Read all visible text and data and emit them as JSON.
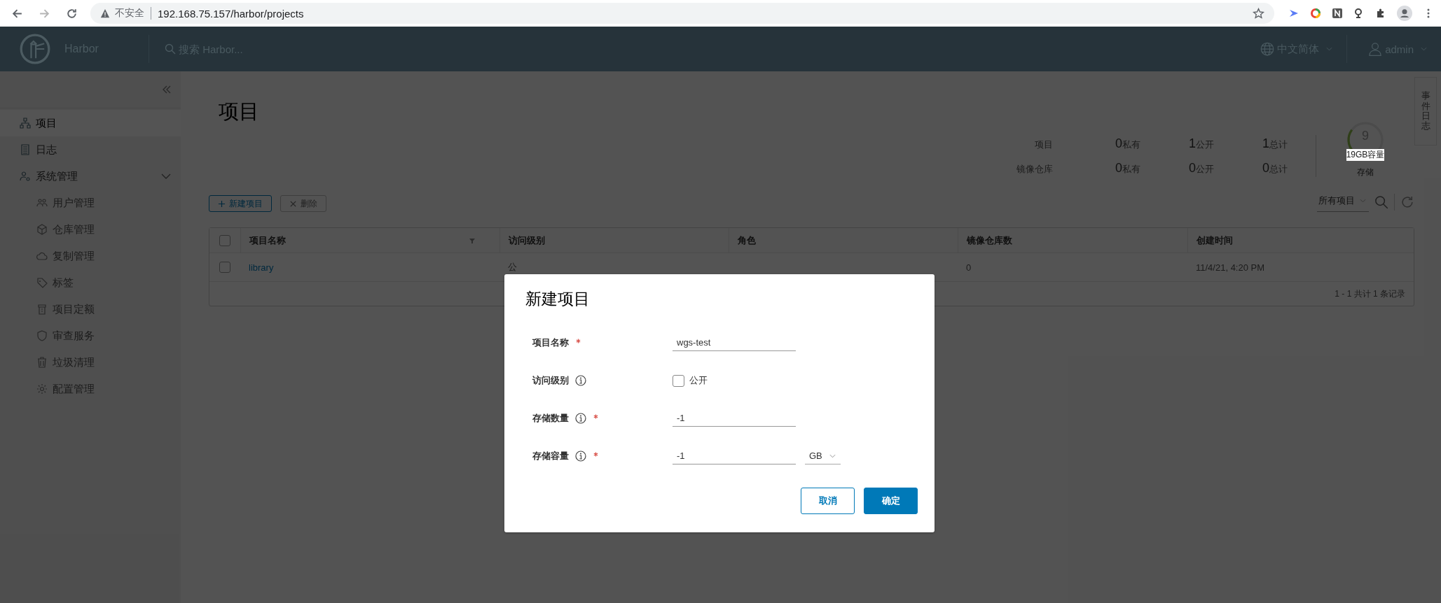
{
  "browser": {
    "security_label": "不安全",
    "url": "192.168.75.157/harbor/projects"
  },
  "header": {
    "brand": "Harbor",
    "search_placeholder": "搜索 Harbor...",
    "language": "中文简体",
    "user": "admin"
  },
  "sidebar": {
    "items": [
      {
        "label": "项目",
        "selected": true
      },
      {
        "label": "日志",
        "selected": false
      },
      {
        "label": "系统管理",
        "selected": false,
        "expanded": true,
        "children": [
          {
            "label": "用户管理",
            "selected": false
          },
          {
            "label": "仓库管理",
            "selected": false
          },
          {
            "label": "复制管理",
            "selected": false
          },
          {
            "label": "标签",
            "selected": false
          },
          {
            "label": "项目定额",
            "selected": false
          },
          {
            "label": "审查服务",
            "selected": false
          },
          {
            "label": "垃圾清理",
            "selected": false
          },
          {
            "label": "配置管理",
            "selected": false
          }
        ]
      }
    ]
  },
  "page": {
    "title": "项目",
    "stats": [
      {
        "label": "项目",
        "cells": [
          {
            "value": "0",
            "unit": "私有"
          },
          {
            "value": "1",
            "unit": "公开"
          },
          {
            "value": "1",
            "unit": "总计"
          }
        ]
      },
      {
        "label": "镜像仓库",
        "cells": [
          {
            "value": "0",
            "unit": "私有"
          },
          {
            "value": "0",
            "unit": "公开"
          },
          {
            "value": "0",
            "unit": "总计"
          }
        ]
      }
    ],
    "storage": {
      "value": "9",
      "capacity": "19GB容量",
      "label": "存储",
      "level": 0.3
    },
    "event_tab": "事件日志",
    "buttons": [
      {
        "label": "新建项目",
        "disabled": false
      },
      {
        "label": "删除",
        "disabled": true
      }
    ],
    "filter": "所有项目"
  },
  "table": {
    "all_selected": false,
    "columns": [
      "项目名称",
      "访问级别",
      "角色",
      "镜像仓库数",
      "创建时间"
    ],
    "rows": [
      {
        "selected": false,
        "cells": [
          "library",
          "公",
          "",
          "0",
          "11/4/21, 4:20 PM"
        ]
      }
    ],
    "footer": "1 - 1 共计 1 条记录"
  },
  "dialog": {
    "title": "新建项目",
    "fields": [
      {
        "kind": "text",
        "label": "项目名称",
        "info": false,
        "required": true,
        "value": "wgs-test"
      },
      {
        "kind": "checkbox",
        "label": "访问级别",
        "info": true,
        "required": false,
        "checked": false,
        "option": "公开"
      },
      {
        "kind": "text",
        "label": "存储数量",
        "info": true,
        "required": true,
        "value": "-1"
      },
      {
        "kind": "unit",
        "label": "存储容量",
        "info": true,
        "required": true,
        "value": "-1",
        "unit": "GB"
      }
    ],
    "buttons": [
      {
        "label": "取消",
        "kind": "secondary"
      },
      {
        "label": "确定",
        "kind": "primary"
      }
    ]
  }
}
